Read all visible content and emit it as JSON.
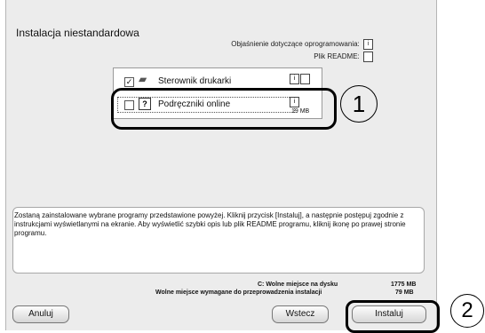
{
  "window": {
    "title": "Instalacja niestandardowa"
  },
  "hints": {
    "description_label": "Objaśnienie dotyczące oprogramowania:",
    "readme_label": "Plik README:"
  },
  "items": [
    {
      "label": "Sterownik drukarki",
      "checked": true,
      "check_mark": "✓"
    },
    {
      "label": "Podręczniki online",
      "checked": false,
      "size": "19 MB",
      "book_glyph": "?"
    }
  ],
  "info_glyph": "i",
  "description": "Zostaną zainstalowane wybrane programy przedstawione powyżej. Kliknij przycisk [Instaluj], a następnie postępuj zgodnie z instrukcjami wyświetlanymi na ekranie. Aby wyświetlić szybki opis lub plik README programu, kliknij ikonę po prawej stronie programu.",
  "disk": {
    "free_label": "C: Wolne miejsce na dysku",
    "free_value": "1775 MB",
    "required_label": "Wolne miejsce wymagane do przeprowadzenia instalacji",
    "required_value": "79 MB"
  },
  "buttons": {
    "cancel": "Anuluj",
    "back": "Wstecz",
    "install": "Instaluj"
  },
  "annotations": {
    "one": "1",
    "two": "2"
  }
}
